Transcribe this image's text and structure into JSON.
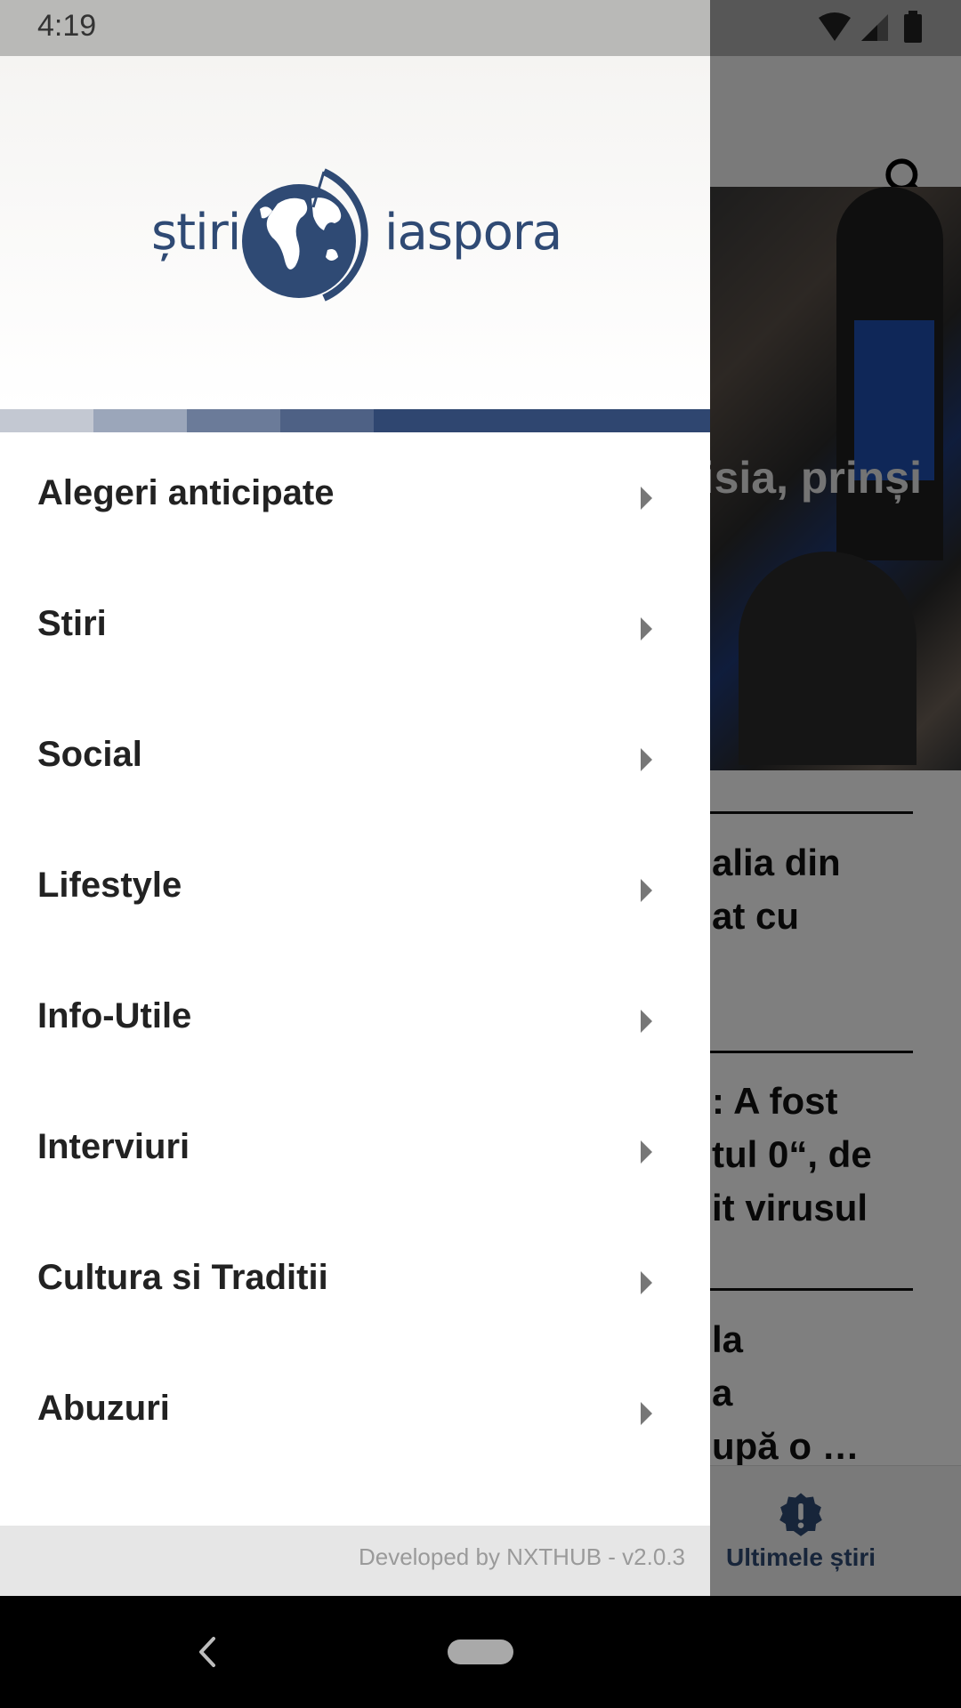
{
  "status_bar": {
    "time": "4:19"
  },
  "background": {
    "hero_title_fragment": "isia, prinși",
    "articles": [
      {
        "lines": [
          "alia din",
          "at cu"
        ]
      },
      {
        "lines": [
          ": A fost",
          "tul 0“, de",
          "it virusul"
        ]
      },
      {
        "lines": [
          "la",
          "a",
          "upă o …"
        ]
      }
    ],
    "bottom_nav_label": "Ultimele știri",
    "search_icon": "search-icon",
    "badge_icon": "alert-badge-icon"
  },
  "drawer": {
    "logo": {
      "left": "știri",
      "right": "iaspora"
    },
    "stripe_colors": [
      "#c3c8d2",
      "#9ba6ba",
      "#6b7b99",
      "#4e6185",
      "#2f4670"
    ],
    "menu_items": [
      {
        "label": "Alegeri anticipate"
      },
      {
        "label": "Stiri"
      },
      {
        "label": "Social"
      },
      {
        "label": "Lifestyle"
      },
      {
        "label": "Info-Utile"
      },
      {
        "label": "Interviuri"
      },
      {
        "label": "Cultura si Traditii"
      },
      {
        "label": "Abuzuri"
      }
    ],
    "footer": "Developed by NXTHUB - v2.0.3"
  },
  "colors": {
    "brand": "#2f4a74"
  }
}
